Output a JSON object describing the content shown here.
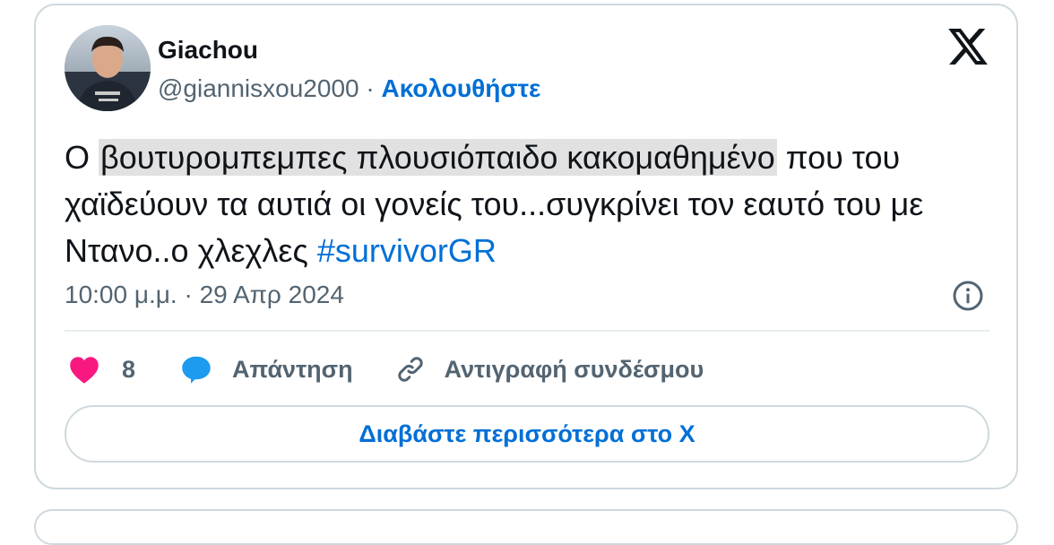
{
  "author": {
    "name": "Giachou",
    "handle": "@giannisxou2000",
    "separator": "·",
    "follow_label": "Ακολουθήστε"
  },
  "tweet": {
    "text_before": "Ο ",
    "highlighted": "βουτυρομπεμπες πλουσιόπαιδο κακομαθημένο",
    "text_after": " που του χαϊδεύουν τα αυτιά οι γονείς του...συγκρίνει τον εαυτό του με Ντανο..ο χλεχλες ",
    "hashtag": "#survivorGR",
    "time": "10:00 μ.μ.",
    "meta_separator": " · ",
    "date": "29 Απρ 2024"
  },
  "actions": {
    "like_count": "8",
    "reply_label": "Απάντηση",
    "copy_link_label": "Αντιγραφή συνδέσμου"
  },
  "read_more_label": "Διαβάστε περισσότερα στο X",
  "icons": {
    "logo": "x-logo-icon",
    "info": "info-icon",
    "like": "heart-icon",
    "reply": "speech-bubble-icon",
    "copy": "link-icon"
  },
  "colors": {
    "link": "#006fd6",
    "secondary_text": "#536471",
    "like": "#f91880",
    "reply": "#1d9bf0",
    "border": "#cfd9de",
    "highlight": "#e1e1e1"
  }
}
